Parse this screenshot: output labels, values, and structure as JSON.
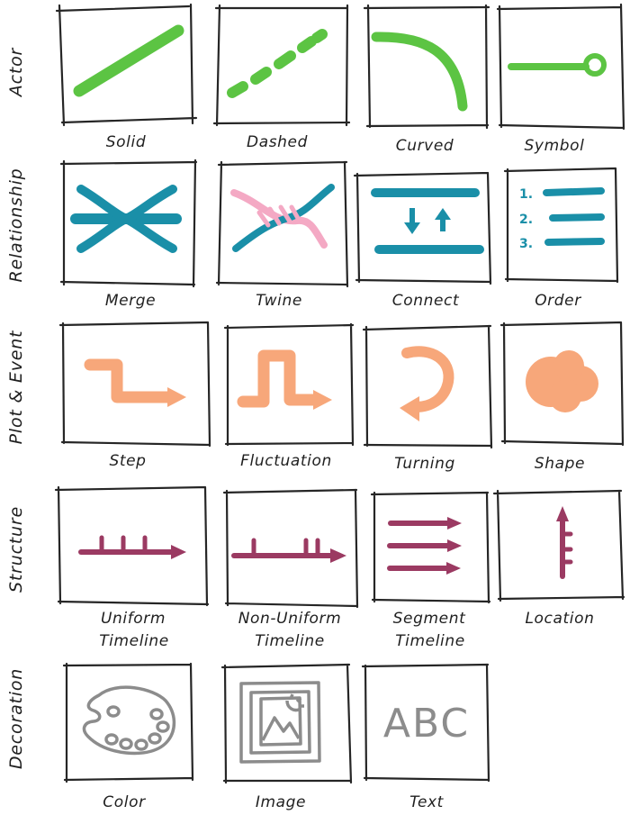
{
  "rows": [
    {
      "label": "Actor",
      "color": "#5cc443",
      "items": [
        {
          "label": "Solid",
          "icon": "solid-line-icon"
        },
        {
          "label": "Dashed",
          "icon": "dashed-line-icon"
        },
        {
          "label": "Curved",
          "icon": "curved-line-icon"
        },
        {
          "label": "Symbol",
          "icon": "line-with-circle-symbol-icon"
        }
      ]
    },
    {
      "label": "Relationship",
      "color": "#1a8fa8",
      "accent": "#f4a9c4",
      "items": [
        {
          "label": "Merge",
          "icon": "merge-lines-icon"
        },
        {
          "label": "Twine",
          "icon": "twine-lines-icon"
        },
        {
          "label": "Connect",
          "icon": "connect-arrows-icon"
        },
        {
          "label": "Order",
          "icon": "ordered-list-icon",
          "numbers": [
            "1.",
            "2.",
            "3."
          ]
        }
      ]
    },
    {
      "label": "Plot & Event",
      "color": "#f7a77a",
      "items": [
        {
          "label": "Step",
          "icon": "step-arrow-icon"
        },
        {
          "label": "Fluctuation",
          "icon": "fluctuation-arrow-icon"
        },
        {
          "label": "Turning",
          "icon": "turning-arrow-icon"
        },
        {
          "label": "Shape",
          "icon": "blob-shape-icon"
        }
      ]
    },
    {
      "label": "Structure",
      "color": "#9b3a62",
      "items": [
        {
          "label": "Uniform",
          "label2": "Timeline",
          "icon": "uniform-timeline-icon"
        },
        {
          "label": "Non-Uniform",
          "label2": "Timeline",
          "icon": "non-uniform-timeline-icon"
        },
        {
          "label": "Segment",
          "label2": "Timeline",
          "icon": "segment-timeline-icon"
        },
        {
          "label": "Location",
          "icon": "location-timeline-icon"
        }
      ]
    },
    {
      "label": "Decoration",
      "color": "#8c8c8c",
      "items": [
        {
          "label": "Color",
          "icon": "color-palette-icon"
        },
        {
          "label": "Image",
          "icon": "framed-image-icon"
        },
        {
          "label": "Text",
          "icon": "text-abc-icon",
          "sample": "ABC"
        }
      ]
    }
  ]
}
